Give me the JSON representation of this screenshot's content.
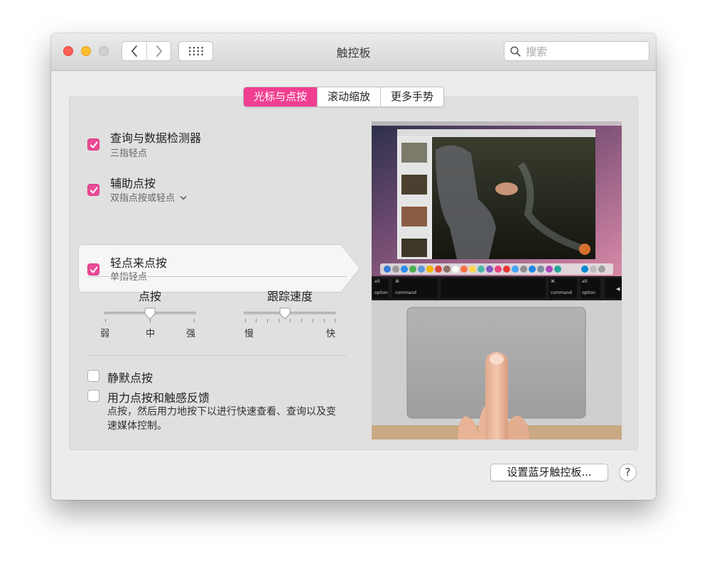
{
  "window": {
    "title": "触控板",
    "search_placeholder": "搜索"
  },
  "tabs": [
    {
      "label": "光标与点按",
      "active": true
    },
    {
      "label": "滚动缩放",
      "active": false
    },
    {
      "label": "更多手势",
      "active": false
    }
  ],
  "options": [
    {
      "title": "查询与数据检测器",
      "subtitle": "三指轻点",
      "checked": true
    },
    {
      "title": "辅助点按",
      "subtitle": "双指点按或轻点",
      "checked": true,
      "has_dropdown": true
    },
    {
      "title": "轻点来点按",
      "subtitle": "单指轻点",
      "checked": true,
      "selected": true
    }
  ],
  "sliders": {
    "click": {
      "label": "点按",
      "min_label": "弱",
      "mid_label": "中",
      "max_label": "强",
      "value": 0.5
    },
    "tracking": {
      "label": "跟踪速度",
      "min_label": "慢",
      "max_label": "快",
      "value": 0.45
    }
  },
  "bottom_options": [
    {
      "title": "静默点按",
      "checked": false
    },
    {
      "title": "用力点按和触感反馈",
      "checked": false,
      "description_line1": "点按，然后用力地按下以进行快速查看、查询以及变",
      "description_line2": "速媒体控制。"
    }
  ],
  "keyboard": {
    "left_option_alt": "alt",
    "left_option": "option",
    "left_command_symbol": "⌘",
    "left_command": "command",
    "right_command_symbol": "⌘",
    "right_command": "command",
    "right_option_alt": "alt",
    "right_option": "option"
  },
  "buttons": {
    "bluetooth": "设置蓝牙触控板...",
    "help": "?"
  },
  "colors": {
    "accent": "#f03f91",
    "checkbox": "#ec4b95",
    "close": "#fe5f57",
    "minimize": "#febc2e"
  },
  "icons": [
    "chevron-left-icon",
    "chevron-right-icon",
    "grid-icon",
    "search-icon",
    "checkmark-icon",
    "chevron-down-icon"
  ]
}
